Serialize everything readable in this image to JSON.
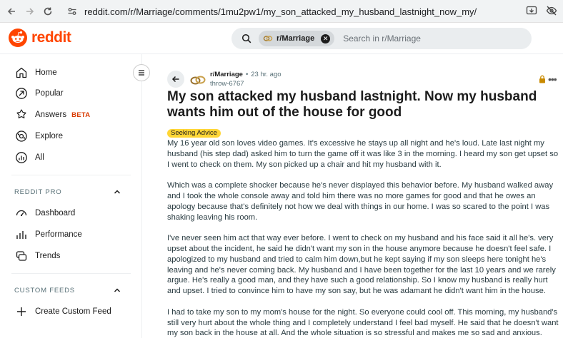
{
  "browser": {
    "url": "reddit.com/r/Marriage/comments/1mu2pw1/my_son_attacked_my_husband_lastnight_now_my/",
    "back_icon": "arrow-left-icon",
    "forward_icon": "arrow-right-icon",
    "reload_icon": "reload-icon"
  },
  "header": {
    "logo_text": "reddit",
    "search_chip": "r/Marriage",
    "search_placeholder": "Search in r/Marriage",
    "brand_color": "#ff4500"
  },
  "sidebar": {
    "items": [
      {
        "label": "Home",
        "icon": "home-icon"
      },
      {
        "label": "Popular",
        "icon": "popular-icon"
      },
      {
        "label": "Answers",
        "icon": "answers-icon",
        "badge": "BETA"
      },
      {
        "label": "Explore",
        "icon": "explore-icon"
      },
      {
        "label": "All",
        "icon": "all-icon"
      }
    ],
    "pro": {
      "title": "REDDIT PRO",
      "items": [
        {
          "label": "Dashboard",
          "icon": "dashboard-icon"
        },
        {
          "label": "Performance",
          "icon": "performance-icon"
        },
        {
          "label": "Trends",
          "icon": "trends-icon"
        }
      ]
    },
    "feeds": {
      "title": "CUSTOM FEEDS",
      "items": [
        {
          "label": "Create Custom Feed",
          "icon": "plus-icon"
        }
      ]
    }
  },
  "post": {
    "subreddit": "r/Marriage",
    "separator": "•",
    "time": "23 hr. ago",
    "author": "throw-6767",
    "title": "My son attacked my husband lastnight. Now my husband wants him out of the house for good",
    "flair": "Seeking Advice",
    "flair_color": "#ffd635",
    "paragraphs": [
      "My 16 year old son loves video games. It's excessive he stays up all night and he's loud. Late last night my husband (his step dad) asked him to turn the game off it was like 3 in the morning. I heard my son get upset so I went to check on them. My son picked up a chair and hit my husband with it.",
      "Which was a complete shocker because he's never displayed this behavior before. My husband walked away and I took the whole console away and told him there was no more games for good and that he owes an apology because that's definitely not how we deal with things in our home. I was so scared to the point I was shaking leaving his room.",
      "I've never seen him act that way ever before. I went to check on my husband and his face said it all he's. very upset about the incident, he said he didn't want my son in the house anymore because he doesn't feel safe. I apologized to my husband and tried to calm him down,but he kept saying if my son sleeps here tonight he's leaving and he's never coming back. My husband and I have been together for the last 10 years and we rarely argue. He's really a good man, and they have such a good relationship. So I know my husband is really hurt and upset. I tried to convince him to have my son say, but he was adamant he didn't want him in the house.",
      "I had to take my son to my mom's house for the night. So everyone could cool off. This morning, my husband's still very hurt about the whole thing and I completely understand I feel bad myself. He said that he doesn't want my son back in the house at all. And the whole situation is so stressful and makes me so sad and anxious."
    ]
  }
}
